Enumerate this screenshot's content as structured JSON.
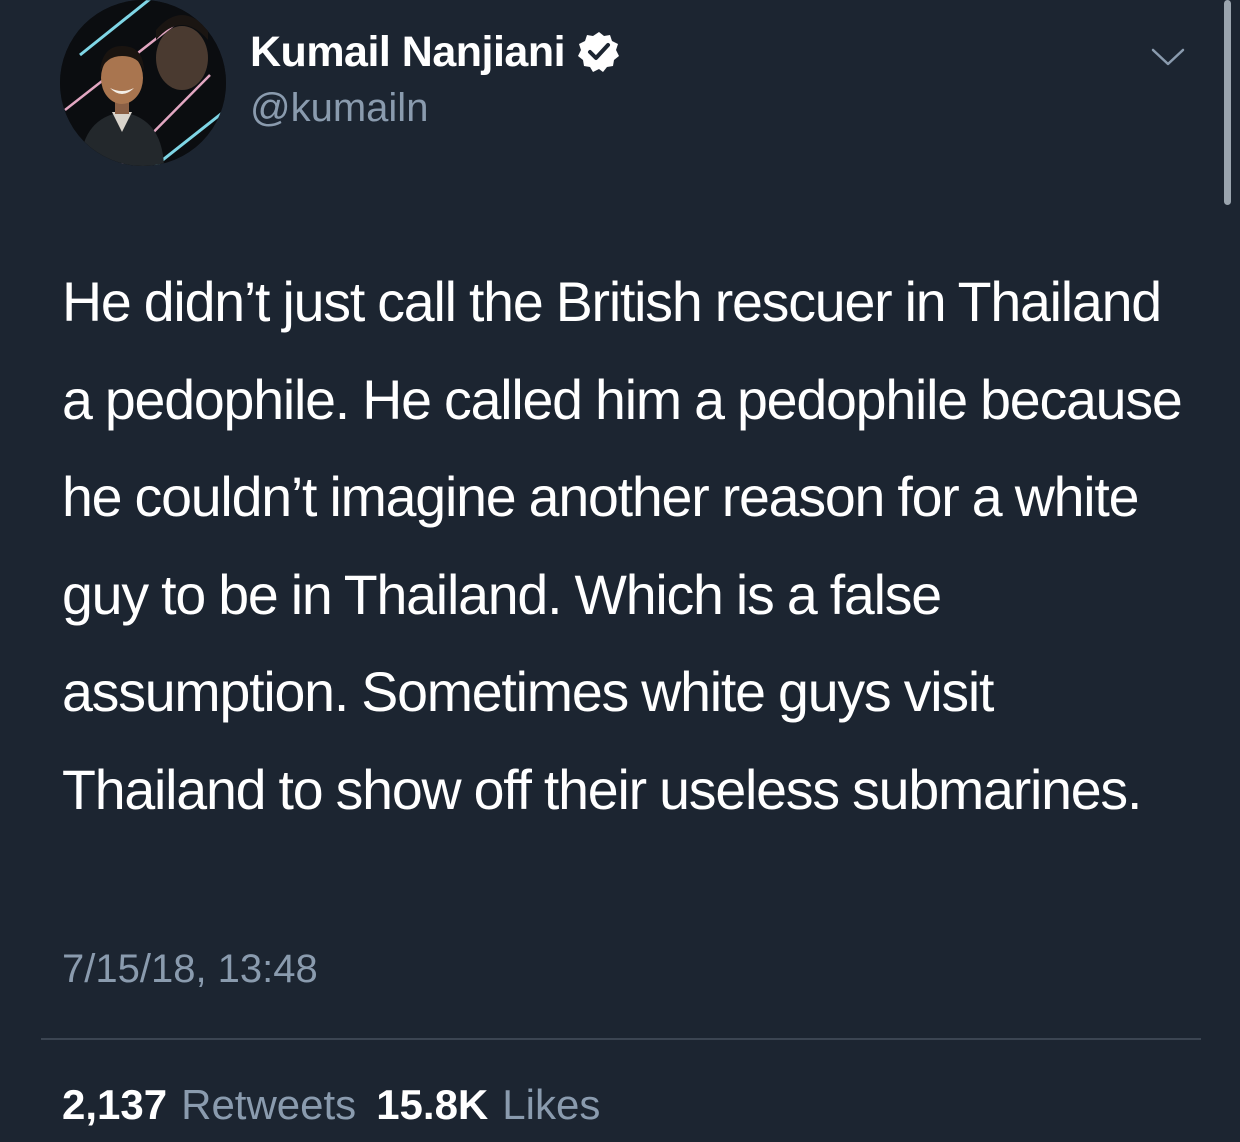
{
  "user": {
    "display_name": "Kumail Nanjiani",
    "handle": "@kumailn",
    "verified": true
  },
  "tweet": {
    "text": "He didn’t just call the British rescuer in Thailand a pedophile. He called him a pedophile because he couldn’t imagine another reason for a white guy to be in Thailand. Which is a false assumption. Sometimes white guys visit Thailand to show off their useless submarines.",
    "timestamp": "7/15/18, 13:48"
  },
  "stats": {
    "retweets_count": "2,137",
    "retweets_label": "Retweets",
    "likes_count": "15.8K",
    "likes_label": "Likes"
  },
  "icons": {
    "verified": "verified-badge-icon",
    "menu": "chevron-down-icon"
  },
  "colors": {
    "background": "#1c2531",
    "secondary_text": "#8a9bae",
    "divider": "#3b4552"
  }
}
